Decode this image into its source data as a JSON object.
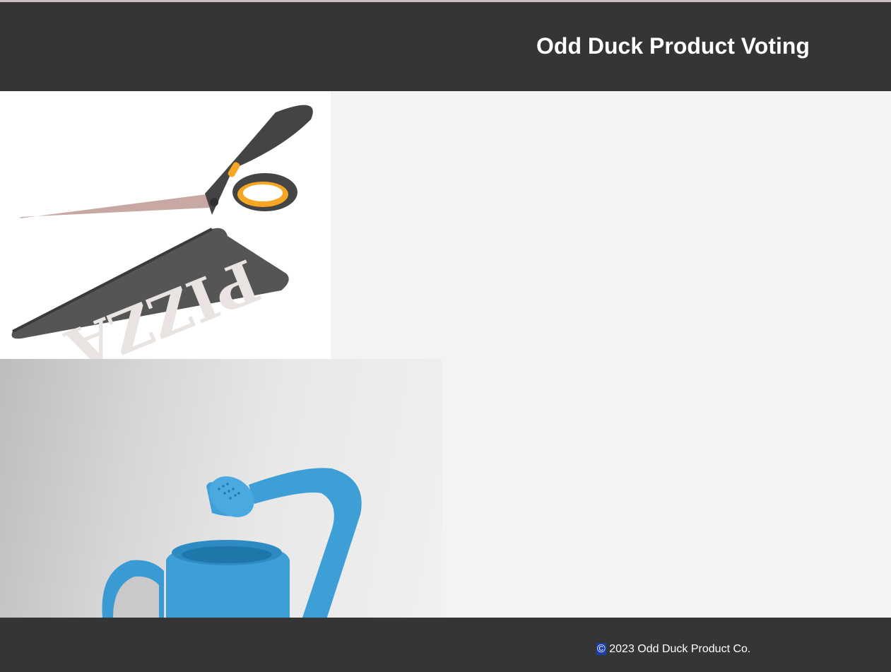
{
  "header": {
    "title": "Odd Duck Product Voting"
  },
  "products": [
    {
      "image_text": "PIZZA",
      "subject": "pizza-scissors"
    },
    {
      "subject": "watering-can"
    }
  ],
  "footer": {
    "copyright_symbol": "©",
    "copyright_text": " 2023 Odd Duck Product Co."
  },
  "colors": {
    "header_bg": "#353535",
    "page_bg": "#f3f3f3",
    "text": "#ffffff",
    "accent_blade_handle": "#f5a623",
    "watering_can": "#3d9fd6"
  }
}
